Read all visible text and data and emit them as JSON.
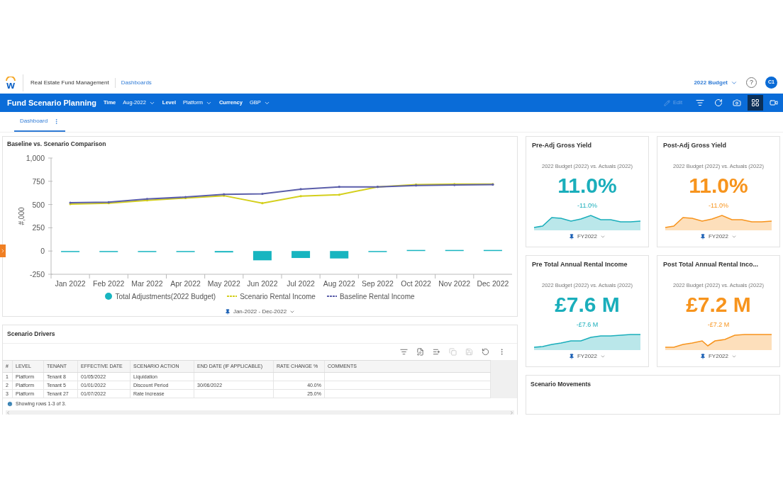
{
  "header": {
    "logo_letter": "w",
    "app": "Real Estate Fund Management",
    "breadcrumb": "Dashboards",
    "budget": "2022 Budget",
    "help": "?",
    "avatar": "C1"
  },
  "bar": {
    "title": "Fund Scenario Planning",
    "filters": [
      {
        "label": "Time",
        "value": "Aug-2022"
      },
      {
        "label": "Level",
        "value": "Platform"
      },
      {
        "label": "Currency",
        "value": "GBP"
      }
    ],
    "edit": {
      "label": "Edit",
      "disabled": true
    },
    "tools": [
      {
        "kind": "filter",
        "selected": false
      },
      {
        "kind": "refresh",
        "selected": false
      },
      {
        "kind": "snapshot",
        "selected": false
      },
      {
        "kind": "grid",
        "selected": true
      },
      {
        "kind": "video",
        "selected": false
      }
    ]
  },
  "tabs": [
    {
      "label": "Dashboard",
      "selected": true
    }
  ],
  "comparison": {
    "title": "Baseline vs. Scenario Comparison",
    "range": "Jan-2022 - Dec-2022",
    "chart_data": {
      "type": "line",
      "ylabel": "#,000",
      "categories": [
        "Jan 2022",
        "Feb 2022",
        "Mar 2022",
        "Apr 2022",
        "May 2022",
        "Jun 2022",
        "Jul 2022",
        "Aug 2022",
        "Sep 2022",
        "Oct 2022",
        "Nov 2022",
        "Dec 2022"
      ],
      "ylim": [
        -250,
        1000
      ],
      "yticks": [
        {
          "value": -250,
          "label": "-250"
        },
        {
          "value": 0,
          "label": "0"
        },
        {
          "value": 250,
          "label": "250"
        },
        {
          "value": 500,
          "label": "500"
        },
        {
          "value": 750,
          "label": "750"
        },
        {
          "value": 1000,
          "label": "1,000"
        }
      ],
      "series": [
        {
          "name": "Total Adjustments(2022 Budget)",
          "type": "bar",
          "color": "#17b5c0",
          "values": [
            -10,
            -10,
            -10,
            -10,
            -15,
            -100,
            -75,
            -80,
            -5,
            5,
            10,
            5
          ]
        },
        {
          "name": "Scenario Rental Income",
          "type": "line",
          "color": "#d4cf1c",
          "values": [
            505,
            515,
            545,
            570,
            595,
            515,
            590,
            605,
            690,
            715,
            720,
            720
          ]
        },
        {
          "name": "Baseline Rental Income",
          "type": "line",
          "color": "#5b5eaa",
          "values": [
            520,
            525,
            560,
            580,
            610,
            615,
            665,
            690,
            690,
            705,
            710,
            715
          ]
        }
      ]
    }
  },
  "drivers": {
    "title": "Scenario Drivers",
    "tools": [
      {
        "kind": "filter",
        "disabled": false
      },
      {
        "kind": "edit",
        "disabled": false
      },
      {
        "kind": "add",
        "disabled": false
      },
      {
        "kind": "copy",
        "disabled": true
      },
      {
        "kind": "save",
        "disabled": true
      },
      {
        "kind": "refresh",
        "disabled": false
      },
      {
        "kind": "more",
        "disabled": false
      }
    ],
    "columns": [
      "#",
      "LEVEL",
      "TENANT",
      "EFFECTIVE DATE",
      "SCENARIO ACTION",
      "END DATE (IF APPLICABLE)",
      "RATE CHANGE %",
      "COMMENTS"
    ],
    "rows": [
      [
        "1",
        "Platform",
        "Tenant 8",
        "01/05/2022",
        "Liquidation",
        "",
        "",
        ""
      ],
      [
        "2",
        "Platform",
        "Tenant 5",
        "01/01/2022",
        "Discount Period",
        "30/06/2022",
        "40.0%",
        ""
      ],
      [
        "3",
        "Platform",
        "Tenant 27",
        "01/07/2022",
        "Rate Increase",
        "",
        "25.0%",
        ""
      ]
    ],
    "footer": "Showing rows 1-3 of 3."
  },
  "cards": [
    {
      "title": "Pre-Adj Gross Yield",
      "subtitle": "2022 Budget (2022) vs. Actuals (2022)",
      "value": "11.0%",
      "delta": "-11.0%",
      "period": "FY2022",
      "color": "#1aaebb",
      "kind": "yield"
    },
    {
      "title": "Post-Adj Gross Yield",
      "subtitle": "2022 Budget (2022) vs. Actuals (2022)",
      "value": "11.0%",
      "delta": "-11.0%",
      "period": "FY2022",
      "color": "#f7941d",
      "kind": "yield"
    },
    {
      "title": "Pre Total Annual Rental Income",
      "subtitle": "2022 Budget (2022) vs. Actuals (2022)",
      "value": "£7.6 M",
      "delta": "-£7.6 M",
      "period": "FY2022",
      "color": "#1aaebb",
      "kind": "income"
    },
    {
      "title": "Post Total Annual Rental Inco...",
      "subtitle": "2022 Budget (2022) vs. Actuals (2022)",
      "value": "£7.2 M",
      "delta": "-£7.2 M",
      "period": "FY2022",
      "color": "#f7941d",
      "kind": "income-dip"
    }
  ],
  "movements": {
    "title": "Scenario Movements"
  }
}
